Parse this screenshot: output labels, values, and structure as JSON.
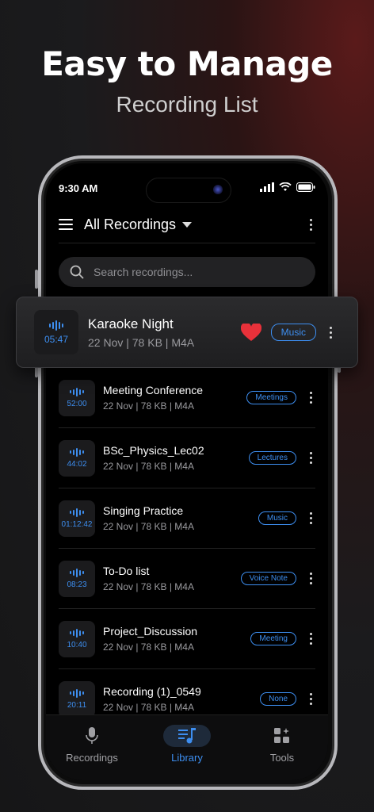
{
  "promo": {
    "headline": "Easy to Manage",
    "subheadline": "Recording List"
  },
  "status_bar": {
    "time": "9:30 AM"
  },
  "app_bar": {
    "title": "All Recordings"
  },
  "search": {
    "placeholder": "Search recordings..."
  },
  "highlighted": {
    "name": "Karaoke Night",
    "meta": "22 Nov | 78 KB | M4A",
    "duration": "05:47",
    "tag": "Music",
    "favorite": true
  },
  "recordings": [
    {
      "name": "Meeting Conference",
      "meta": "22 Nov | 78 KB | M4A",
      "duration": "52:00",
      "tag": "Meetings"
    },
    {
      "name": "BSc_Physics_Lec02",
      "meta": "22 Nov | 78 KB | M4A",
      "duration": "44:02",
      "tag": "Lectures"
    },
    {
      "name": "Singing Practice",
      "meta": "22 Nov | 78 KB | M4A",
      "duration": "01:12:42",
      "tag": "Music"
    },
    {
      "name": "To-Do list",
      "meta": "22 Nov | 78 KB | M4A",
      "duration": "08:23",
      "tag": "Voice Note"
    },
    {
      "name": "Project_Discussion",
      "meta": "22 Nov | 78 KB | M4A",
      "duration": "10:40",
      "tag": "Meeting"
    },
    {
      "name": "Recording (1)_0549",
      "meta": "22 Nov | 78 KB | M4A",
      "duration": "20:11",
      "tag": "None"
    }
  ],
  "tabs": [
    {
      "label": "Recordings",
      "icon": "mic-icon",
      "active": false
    },
    {
      "label": "Library",
      "icon": "music-library-icon",
      "active": true
    },
    {
      "label": "Tools",
      "icon": "tools-grid-icon",
      "active": false
    }
  ],
  "colors": {
    "accent": "#3d8ef0",
    "heart": "#e8313a",
    "background": "#000000"
  }
}
